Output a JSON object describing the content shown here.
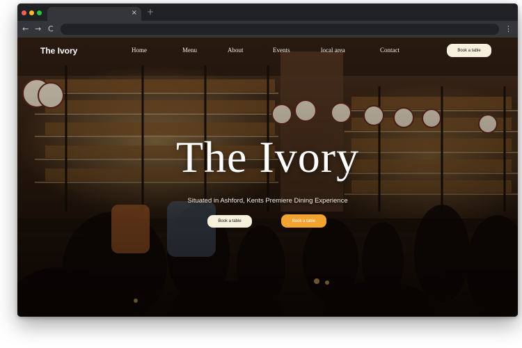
{
  "browser": {
    "tab_close": "×",
    "new_tab": "+",
    "back": "←",
    "forward": "→",
    "reload": "C",
    "menu": "⋮",
    "address_value": ""
  },
  "site": {
    "brand": "The Ivory",
    "nav": [
      "Home",
      "Menu",
      "About",
      "Events",
      "local area",
      "Contact"
    ],
    "book_button": "Book a table"
  },
  "hero": {
    "title": "The Ivory",
    "subtitle": "Situated in Ashford, Kents Premiere Dining Experience",
    "primary_button": "Book a table",
    "secondary_button": "Book a table"
  },
  "colors": {
    "accent": "#f2a431",
    "cream": "#f6f0dc"
  }
}
